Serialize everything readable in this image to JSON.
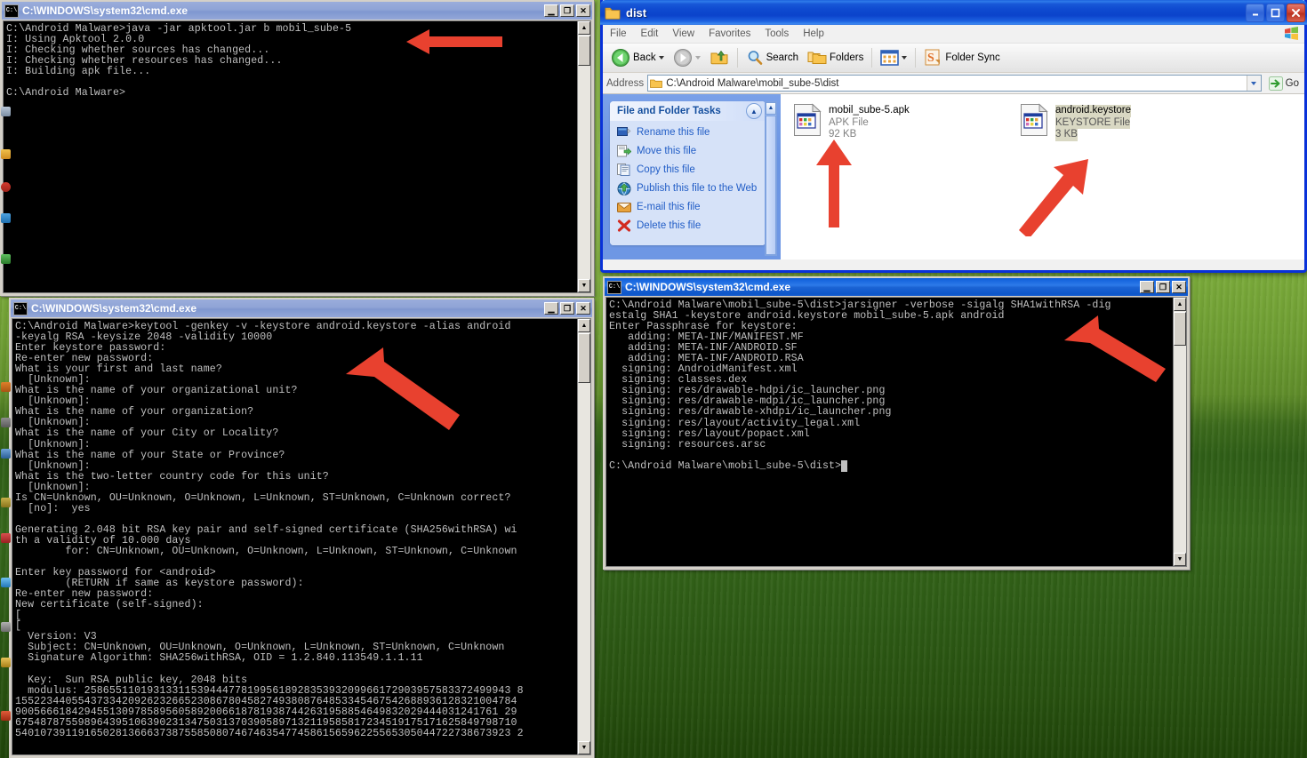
{
  "desktop": {
    "wallpaper": "windows-xp-bliss-green-hill",
    "accent_blue": "#0831d9",
    "arrow_color": "#e8412f"
  },
  "cmd_window_top": {
    "title": "C:\\WINDOWS\\system32\\cmd.exe",
    "icon": "console-icon",
    "active": false,
    "buttons": {
      "minimize": "_",
      "maximize": "❐",
      "close": "✕"
    },
    "console_text": "C:\\Android Malware>java -jar apktool.jar b mobil_sube-5\nI: Using Apktool 2.0.0\nI: Checking whether sources has changed...\nI: Checking whether resources has changed...\nI: Building apk file...\n\nC:\\Android Malware>"
  },
  "cmd_window_keytool": {
    "title": "C:\\WINDOWS\\system32\\cmd.exe",
    "icon": "console-icon",
    "active": false,
    "buttons": {
      "minimize": "_",
      "maximize": "❐",
      "close": "✕"
    },
    "console_text": "C:\\Android Malware>keytool -genkey -v -keystore android.keystore -alias android\n-keyalg RSA -keysize 2048 -validity 10000\nEnter keystore password:\nRe-enter new password:\nWhat is your first and last name?\n  [Unknown]:\nWhat is the name of your organizational unit?\n  [Unknown]:\nWhat is the name of your organization?\n  [Unknown]:\nWhat is the name of your City or Locality?\n  [Unknown]:\nWhat is the name of your State or Province?\n  [Unknown]:\nWhat is the two-letter country code for this unit?\n  [Unknown]:\nIs CN=Unknown, OU=Unknown, O=Unknown, L=Unknown, ST=Unknown, C=Unknown correct?\n  [no]:  yes\n\nGenerating 2.048 bit RSA key pair and self-signed certificate (SHA256withRSA) wi\nth a validity of 10.000 days\n        for: CN=Unknown, OU=Unknown, O=Unknown, L=Unknown, ST=Unknown, C=Unknown\n\nEnter key password for <android>\n        (RETURN if same as keystore password):\nRe-enter new password:\nNew certificate (self-signed):\n[\n[\n  Version: V3\n  Subject: CN=Unknown, OU=Unknown, O=Unknown, L=Unknown, ST=Unknown, C=Unknown\n  Signature Algorithm: SHA256withRSA, OID = 1.2.840.113549.1.1.11\n\n  Key:  Sun RSA public key, 2048 bits\n  modulus: 25865511019313311539444778199561892835393209966172903957583372499943 8\n15522344055437334209262326652308678045827493808764853345467542688936128321004784\n90056661842945513097858956058920066187819387442631958854649832029444031241761 29\n67548787559896439510639023134750313703905897132119585817234519175171625849798710\n5401073911916502813666373875585080746746354774586156596225565305044722738673923 2"
  },
  "cmd_window_jarsigner": {
    "title": "C:\\WINDOWS\\system32\\cmd.exe",
    "icon": "console-icon",
    "active": true,
    "buttons": {
      "minimize": "_",
      "maximize": "❐",
      "close": "✕"
    },
    "console_text": "C:\\Android Malware\\mobil_sube-5\\dist>jarsigner -verbose -sigalg SHA1withRSA -dig\nestalg SHA1 -keystore android.keystore mobil_sube-5.apk android\nEnter Passphrase for keystore:\n   adding: META-INF/MANIFEST.MF\n   adding: META-INF/ANDROID.SF\n   adding: META-INF/ANDROID.RSA\n  signing: AndroidManifest.xml\n  signing: classes.dex\n  signing: res/drawable-hdpi/ic_launcher.png\n  signing: res/drawable-mdpi/ic_launcher.png\n  signing: res/drawable-xhdpi/ic_launcher.png\n  signing: res/layout/activity_legal.xml\n  signing: res/layout/popact.xml\n  signing: resources.arsc\n\nC:\\Android Malware\\mobil_sube-5\\dist>",
    "cursor": "_"
  },
  "explorer": {
    "title": "dist",
    "title_icon": "folder-icon",
    "buttons": {
      "minimize": "_",
      "maximize": "❐",
      "close": "✕"
    },
    "menu": [
      "File",
      "Edit",
      "View",
      "Favorites",
      "Tools",
      "Help"
    ],
    "toolbar": {
      "back": "Back",
      "forward": "",
      "up": "",
      "search": "Search",
      "folders": "Folders",
      "views": "",
      "folder_sync": "Folder Sync"
    },
    "address": {
      "label": "Address",
      "value": "C:\\Android Malware\\mobil_sube-5\\dist",
      "go_label": "Go"
    },
    "tasks_panel": {
      "header": "File and Folder Tasks",
      "items": [
        {
          "label": "Rename this file",
          "icon": "rename-icon"
        },
        {
          "label": "Move this file",
          "icon": "move-icon"
        },
        {
          "label": "Copy this file",
          "icon": "copy-icon"
        },
        {
          "label": "Publish this file to the Web",
          "icon": "publish-web-icon"
        },
        {
          "label": "E-mail this file",
          "icon": "email-icon"
        },
        {
          "label": "Delete this file",
          "icon": "delete-icon"
        }
      ]
    },
    "files": [
      {
        "name": "mobil_sube-5.apk",
        "type": "APK File",
        "size": "92 KB",
        "selected": false,
        "icon": "generic-file-icon"
      },
      {
        "name": "android.keystore",
        "type": "KEYSTORE File",
        "size": "3 KB",
        "selected": true,
        "icon": "generic-file-icon"
      }
    ]
  },
  "annotations": [
    {
      "name": "arrow-to-apktool-build-command",
      "points_to": "java -jar apktool.jar b mobil_sube-5"
    },
    {
      "name": "arrow-to-keytool-genkey-command",
      "points_to": "keytool -genkey ..."
    },
    {
      "name": "arrow-to-apk-file",
      "points_to": "mobil_sube-5.apk"
    },
    {
      "name": "arrow-to-keystore-file",
      "points_to": "android.keystore"
    },
    {
      "name": "arrow-to-jarsigner-command",
      "points_to": "jarsigner -verbose ..."
    }
  ]
}
